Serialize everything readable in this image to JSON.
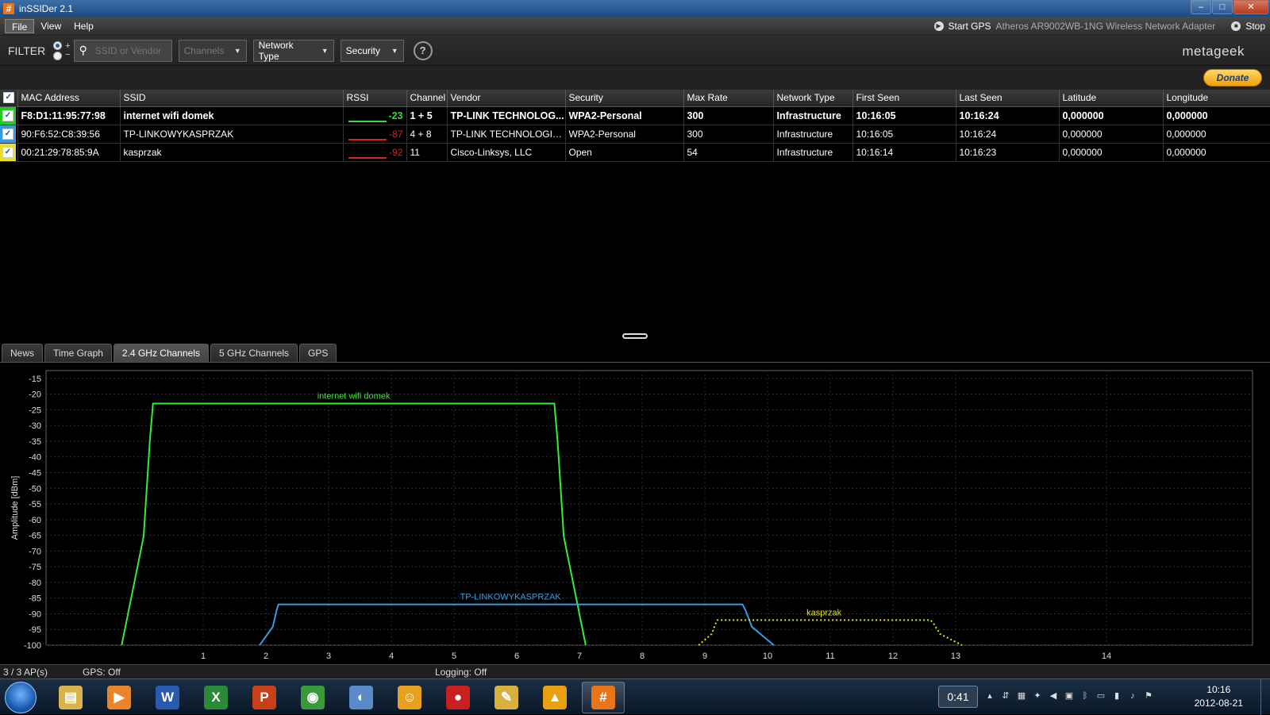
{
  "window": {
    "title": "inSSIDer 2.1",
    "controls": {
      "minimize": "–",
      "maximize": "□",
      "close": "✕"
    }
  },
  "menu": {
    "items": [
      "File",
      "View",
      "Help"
    ],
    "start_gps": "Start GPS",
    "adapter": "Atheros AR9002WB-1NG Wireless Network Adapter",
    "stop": "Stop"
  },
  "filter": {
    "label": "FILTER",
    "plus": "+",
    "minus": "−",
    "search_placeholder": "SSID or Vendor",
    "channels": "Channels",
    "network_type": "Network Type",
    "security": "Security",
    "help": "?"
  },
  "brand": {
    "logo": "metageek",
    "donate": "Donate"
  },
  "table": {
    "columns": [
      "MAC Address",
      "SSID",
      "RSSI",
      "Channel",
      "Vendor",
      "Security",
      "Max Rate",
      "Network Type",
      "First Seen",
      "Last Seen",
      "Latitude",
      "Longitude"
    ],
    "rows": [
      {
        "color": "#22cc22",
        "mac": "F8:D1:11:95:77:98",
        "ssid": "internet wifi domek",
        "rssi": "-23",
        "channel": "1 + 5",
        "vendor": "TP-LINK TECHNOLOG...",
        "security": "WPA2-Personal",
        "max_rate": "300",
        "network_type": "Infrastructure",
        "first_seen": "10:16:05",
        "last_seen": "10:16:24",
        "latitude": "0,000000",
        "longitude": "0,000000",
        "bold": true,
        "rssi_color": "#33dd33"
      },
      {
        "color": "#3a9ae0",
        "mac": "90:F6:52:C8:39:56",
        "ssid": "TP-LINKOWYKASPRZAK",
        "rssi": "-87",
        "channel": "4 + 8",
        "vendor": "TP-LINK TECHNOLOGIES ...",
        "security": "WPA2-Personal",
        "max_rate": "300",
        "network_type": "Infrastructure",
        "first_seen": "10:16:05",
        "last_seen": "10:16:24",
        "latitude": "0,000000",
        "longitude": "0,000000",
        "bold": false,
        "rssi_color": "#dd2222"
      },
      {
        "color": "#e8e020",
        "mac": "00:21:29:78:85:9A",
        "ssid": "kasprzak",
        "rssi": "-92",
        "channel": "11",
        "vendor": "Cisco-Linksys, LLC",
        "security": "Open",
        "max_rate": "54",
        "network_type": "Infrastructure",
        "first_seen": "10:16:14",
        "last_seen": "10:16:23",
        "latitude": "0,000000",
        "longitude": "0,000000",
        "bold": false,
        "rssi_color": "#dd2222"
      }
    ]
  },
  "tabs": [
    {
      "label": "News",
      "active": false
    },
    {
      "label": "Time Graph",
      "active": false
    },
    {
      "label": "2.4 GHz Channels",
      "active": true
    },
    {
      "label": "5 GHz Channels",
      "active": false
    },
    {
      "label": "GPS",
      "active": false
    }
  ],
  "chart_data": {
    "type": "area",
    "ylabel": "Amplitude [dBm]",
    "xlabel": "",
    "ylim": [
      -100,
      -15
    ],
    "y_ticks": [
      -15,
      -20,
      -25,
      -30,
      -35,
      -40,
      -45,
      -50,
      -55,
      -60,
      -65,
      -70,
      -75,
      -80,
      -85,
      -90,
      -95,
      -100
    ],
    "x_ticks": [
      1,
      2,
      3,
      4,
      5,
      6,
      7,
      8,
      9,
      10,
      11,
      12,
      13,
      14
    ],
    "grid": true,
    "series": [
      {
        "name": "internet wifi domek",
        "color": "#33ee33",
        "dashed": false,
        "channel_start": -0.3,
        "channel_end": 7.1,
        "plateau_start": 0.2,
        "plateau_end": 6.6,
        "amplitude": -23
      },
      {
        "name": "TP-LINKOWYKASPRZAK",
        "color": "#3a9ae0",
        "dashed": false,
        "channel_start": 1.9,
        "channel_end": 10.1,
        "plateau_start": 2.2,
        "plateau_end": 9.6,
        "amplitude": -87
      },
      {
        "name": "kasprzak",
        "color": "#e8e020",
        "dashed": true,
        "channel_start": 8.9,
        "channel_end": 13.1,
        "plateau_start": 9.2,
        "plateau_end": 12.6,
        "amplitude": -92
      }
    ]
  },
  "status": {
    "ap_count": "3 / 3 AP(s)",
    "gps": "GPS: Off",
    "logging": "Logging: Off"
  },
  "taskbar": {
    "apps": [
      {
        "name": "explorer",
        "glyph": "▤",
        "color": "#d8b24a"
      },
      {
        "name": "media-player",
        "glyph": "▶",
        "color": "#e8852a"
      },
      {
        "name": "word",
        "glyph": "W",
        "color": "#2a5ab0"
      },
      {
        "name": "excel",
        "glyph": "X",
        "color": "#2a8a3a"
      },
      {
        "name": "powerpoint",
        "glyph": "P",
        "color": "#c8401a"
      },
      {
        "name": "chrome",
        "glyph": "◉",
        "color": "#3a9a3a"
      },
      {
        "name": "messenger",
        "glyph": "◐",
        "color": "#5a8ac8"
      },
      {
        "name": "sun-app",
        "glyph": "☺",
        "color": "#e8a020"
      },
      {
        "name": "record-app",
        "glyph": "●",
        "color": "#c82020"
      },
      {
        "name": "tool-app",
        "glyph": "✎",
        "color": "#d8b040"
      },
      {
        "name": "warning-app",
        "glyph": "▲",
        "color": "#e8a010"
      },
      {
        "name": "inssider",
        "glyph": "#",
        "color": "#e8751a"
      }
    ],
    "timer": "0:41",
    "clock_time": "10:16",
    "clock_date": "2012-08-21"
  }
}
